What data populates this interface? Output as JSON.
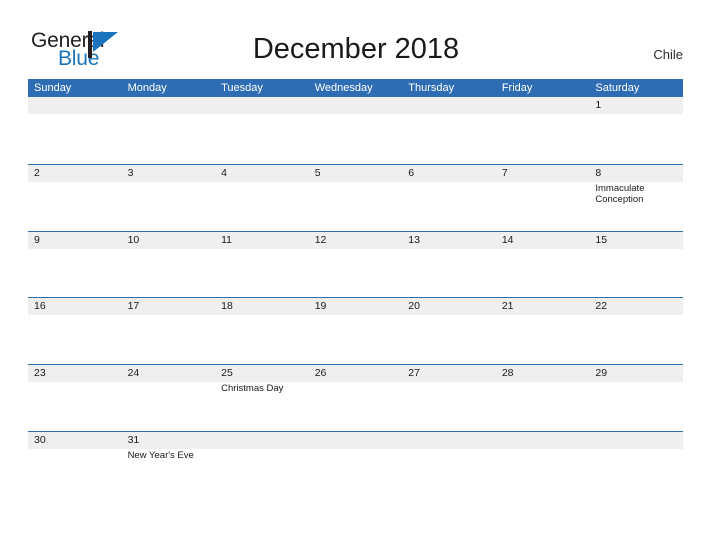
{
  "brand": {
    "name_part1": "General",
    "name_part2": "Blue",
    "flag_color": "#1c75bc",
    "pole_color": "#231f20"
  },
  "header": {
    "title": "December 2018",
    "country": "Chile"
  },
  "colors": {
    "header_blue": "#2E6DB4",
    "row_band_gray": "#efefef",
    "text_dark": "#1a1a1a",
    "header_text": "#ffffff"
  },
  "calendar": {
    "month": "December",
    "year": "2018",
    "weekdays": [
      "Sunday",
      "Monday",
      "Tuesday",
      "Wednesday",
      "Thursday",
      "Friday",
      "Saturday"
    ],
    "weeks": [
      {
        "days": [
          {
            "num": "",
            "event": ""
          },
          {
            "num": "",
            "event": ""
          },
          {
            "num": "",
            "event": ""
          },
          {
            "num": "",
            "event": ""
          },
          {
            "num": "",
            "event": ""
          },
          {
            "num": "",
            "event": ""
          },
          {
            "num": "1",
            "event": ""
          }
        ]
      },
      {
        "days": [
          {
            "num": "2",
            "event": ""
          },
          {
            "num": "3",
            "event": ""
          },
          {
            "num": "4",
            "event": ""
          },
          {
            "num": "5",
            "event": ""
          },
          {
            "num": "6",
            "event": ""
          },
          {
            "num": "7",
            "event": ""
          },
          {
            "num": "8",
            "event": "Immaculate Conception"
          }
        ]
      },
      {
        "days": [
          {
            "num": "9",
            "event": ""
          },
          {
            "num": "10",
            "event": ""
          },
          {
            "num": "11",
            "event": ""
          },
          {
            "num": "12",
            "event": ""
          },
          {
            "num": "13",
            "event": ""
          },
          {
            "num": "14",
            "event": ""
          },
          {
            "num": "15",
            "event": ""
          }
        ]
      },
      {
        "days": [
          {
            "num": "16",
            "event": ""
          },
          {
            "num": "17",
            "event": ""
          },
          {
            "num": "18",
            "event": ""
          },
          {
            "num": "19",
            "event": ""
          },
          {
            "num": "20",
            "event": ""
          },
          {
            "num": "21",
            "event": ""
          },
          {
            "num": "22",
            "event": ""
          }
        ]
      },
      {
        "days": [
          {
            "num": "23",
            "event": ""
          },
          {
            "num": "24",
            "event": ""
          },
          {
            "num": "25",
            "event": "Christmas Day"
          },
          {
            "num": "26",
            "event": ""
          },
          {
            "num": "27",
            "event": ""
          },
          {
            "num": "28",
            "event": ""
          },
          {
            "num": "29",
            "event": ""
          }
        ]
      },
      {
        "days": [
          {
            "num": "30",
            "event": ""
          },
          {
            "num": "31",
            "event": "New Year's Eve"
          },
          {
            "num": "",
            "event": ""
          },
          {
            "num": "",
            "event": ""
          },
          {
            "num": "",
            "event": ""
          },
          {
            "num": "",
            "event": ""
          },
          {
            "num": "",
            "event": ""
          }
        ]
      }
    ]
  }
}
